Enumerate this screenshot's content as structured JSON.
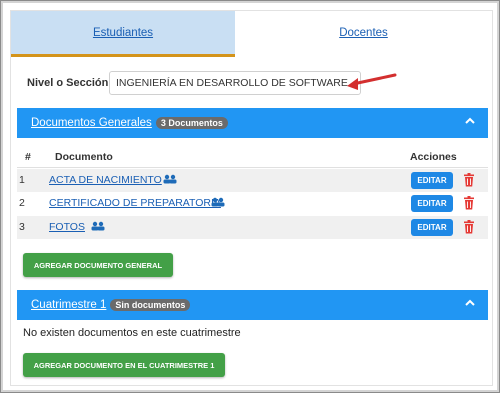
{
  "tabs": [
    {
      "label": "Estudiantes"
    },
    {
      "label": "Docentes"
    }
  ],
  "nivel": {
    "label": "Nivel o Sección",
    "value": "INGENIERÍA EN DESARROLLO DE SOFTWARE"
  },
  "documentos_generales": {
    "title": "Documentos Generales",
    "badge": "3 Documentos",
    "columns": {
      "num": "#",
      "documento": "Documento",
      "acciones": "Acciones"
    },
    "rows": [
      {
        "num": "1",
        "name": "ACTA DE NACIMIENTO",
        "edit": "EDITAR"
      },
      {
        "num": "2",
        "name": "CERTIFICADO DE PREPARATORIA",
        "edit": "EDITAR"
      },
      {
        "num": "3",
        "name": "FOTOS",
        "edit": "EDITAR"
      }
    ],
    "add_button": "AGREGAR DOCUMENTO GENERAL"
  },
  "cuatrimestre": {
    "title": "Cuatrimestre 1",
    "badge": "Sin documentos",
    "empty_message": "No existen documentos en este cuatrimestre",
    "add_button": "AGREGAR DOCUMENTO EN EL CUATRIMESTRE 1"
  },
  "colors": {
    "header_blue": "#2196f3",
    "tab_active_bg": "#c9dff3",
    "tab_underline": "#d4941b",
    "link": "#1a5fb4",
    "edit_button": "#1e88e5",
    "add_button": "#43a047",
    "trash": "#e53935",
    "arrow": "#d32f2f"
  },
  "icons": [
    "people-icon",
    "trash-icon",
    "chevron-up-icon",
    "annotation-arrow"
  ]
}
